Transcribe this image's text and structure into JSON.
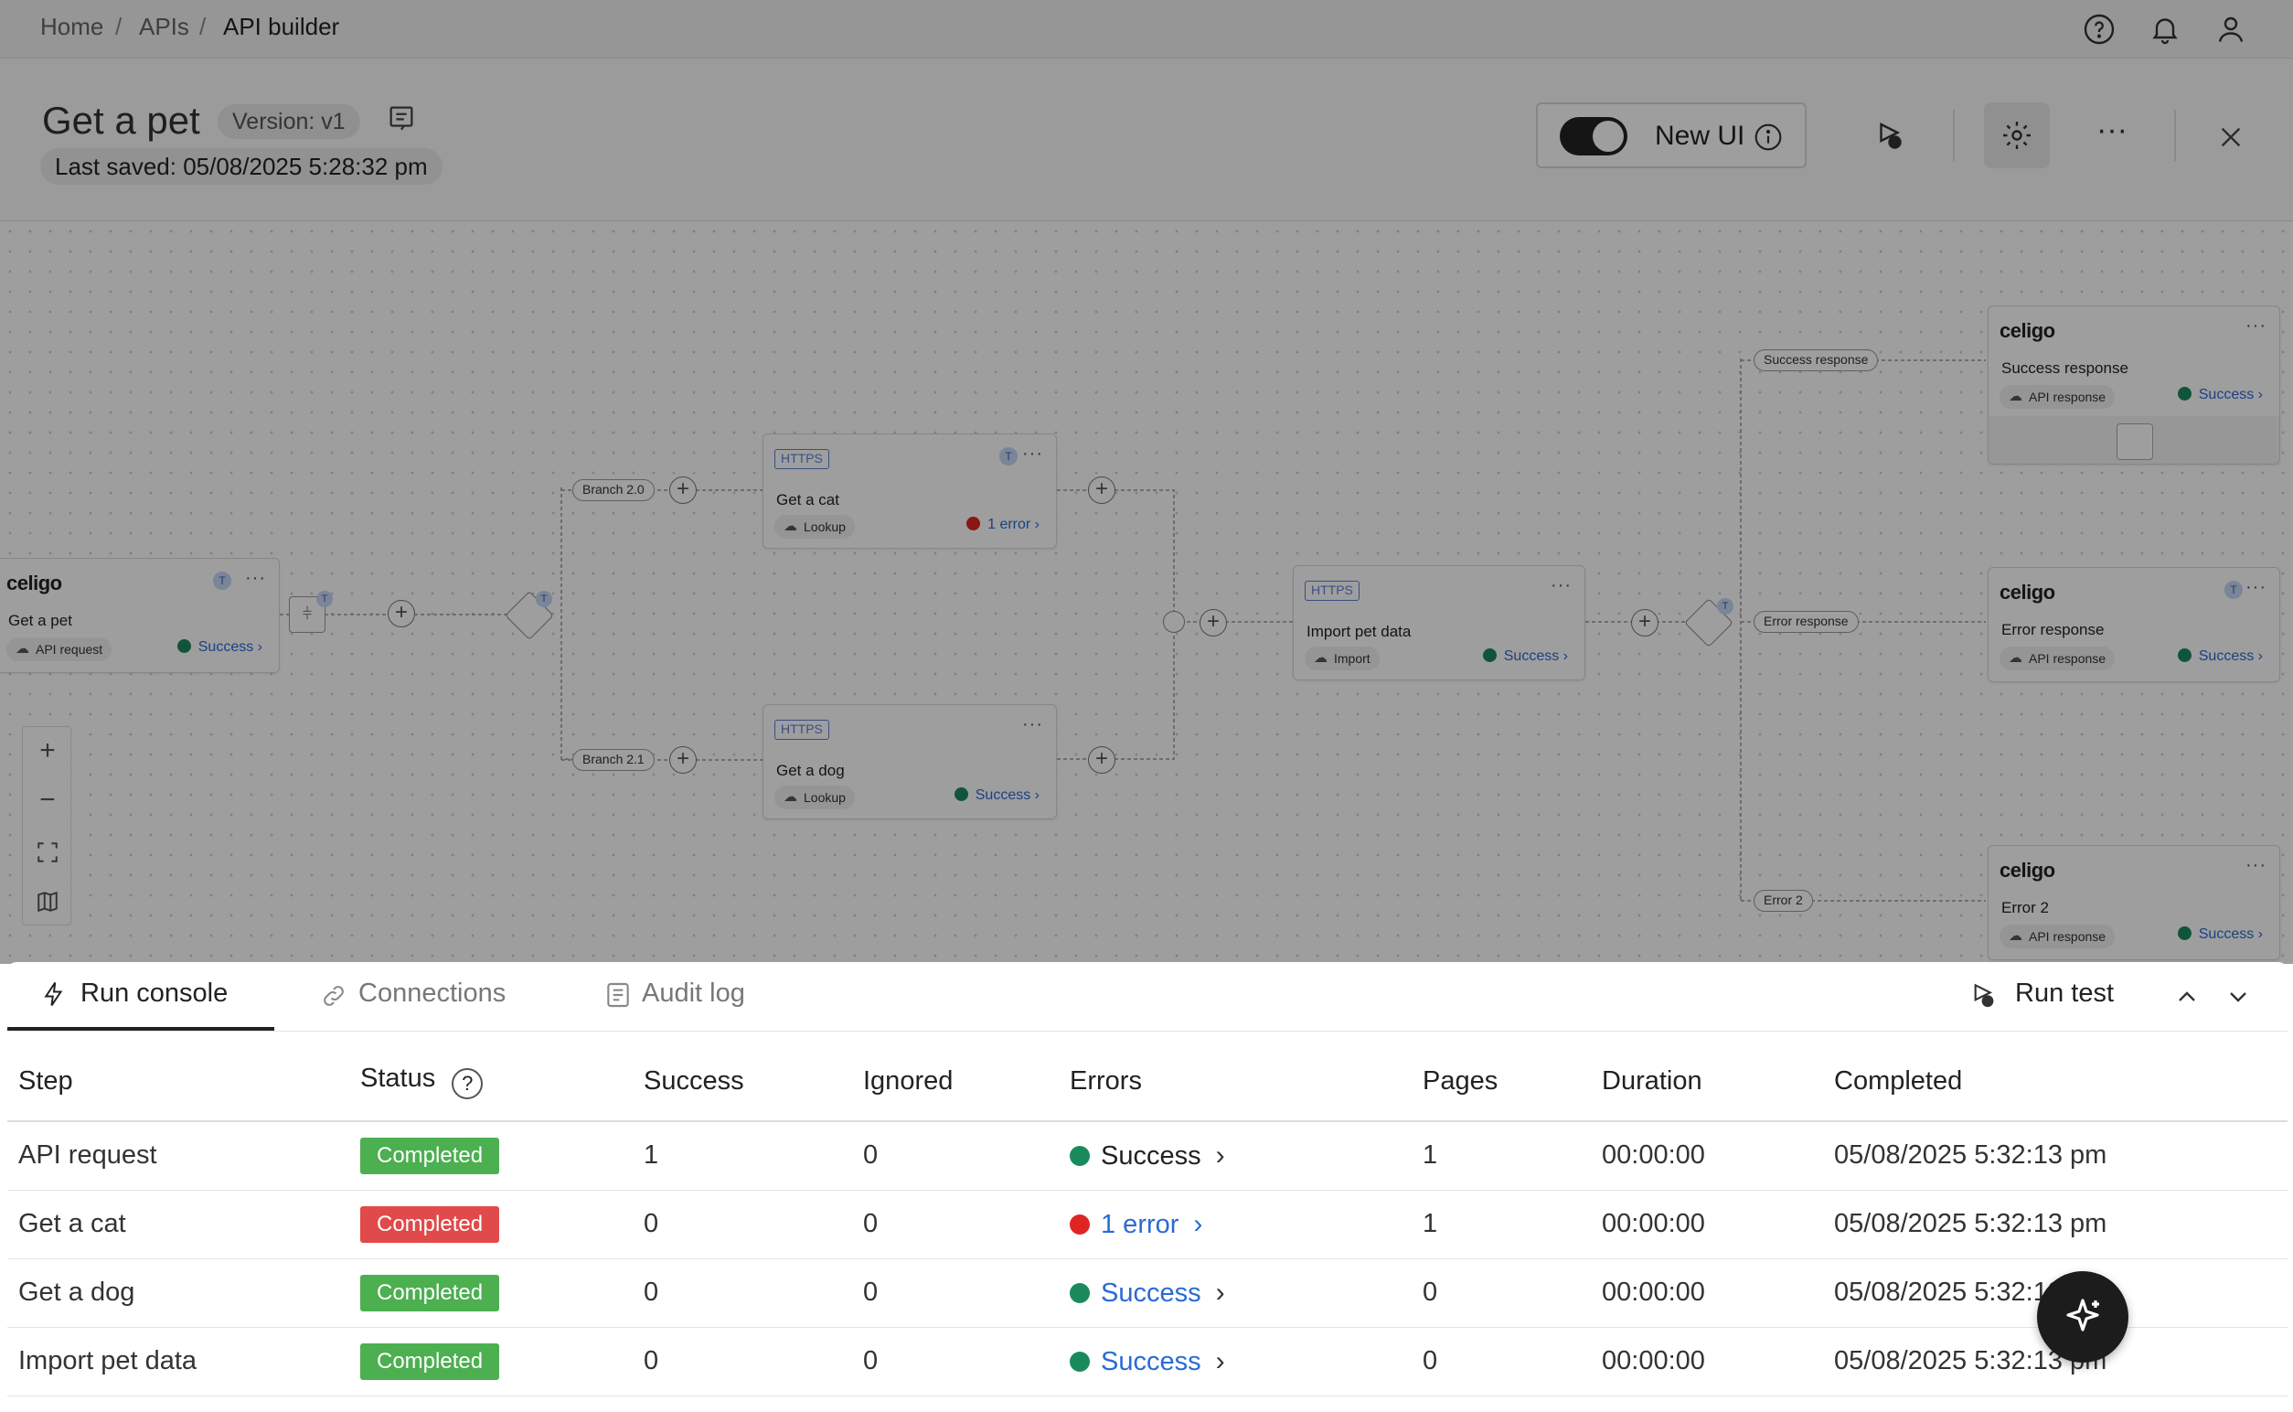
{
  "breadcrumb": {
    "home": "Home",
    "apis": "APIs",
    "current": "API builder",
    "sep": "/"
  },
  "header": {
    "title": "Get a pet",
    "version": "Version: v1",
    "last_saved": "Last saved: 05/08/2025 5:28:32 pm",
    "new_ui_label": "New UI",
    "new_ui_enabled": true,
    "more_label": "···"
  },
  "canvas": {
    "nodes": {
      "get_pet": {
        "brand": "celigo",
        "name": "Get a pet",
        "chip": "API request",
        "status": "Success",
        "badge": "T"
      },
      "get_cat": {
        "tag": "HTTPS",
        "name": "Get a cat",
        "chip": "Lookup",
        "status": "1 error",
        "badge": "T"
      },
      "get_dog": {
        "tag": "HTTPS",
        "name": "Get a dog",
        "chip": "Lookup",
        "status": "Success"
      },
      "import_pet": {
        "tag": "HTTPS",
        "name": "Import pet data",
        "chip": "Import",
        "status": "Success"
      },
      "success_resp": {
        "brand": "celigo",
        "name": "Success response",
        "chip": "API response",
        "status": "Success"
      },
      "error_resp": {
        "brand": "celigo",
        "name": "Error response",
        "chip": "API response",
        "status": "Success",
        "badge": "T"
      },
      "error2": {
        "brand": "celigo",
        "name": "Error 2",
        "chip": "API response",
        "status": "Success"
      }
    },
    "branch_labels": {
      "b20": "Branch 2.0",
      "b21": "Branch 2.1",
      "success": "Success response",
      "error": "Error response",
      "error2": "Error 2"
    },
    "more": "···"
  },
  "panel": {
    "tabs": [
      "Run console",
      "Connections",
      "Audit log"
    ],
    "run_test": "Run test",
    "columns": [
      "Step",
      "Status",
      "Success",
      "Ignored",
      "Errors",
      "Pages",
      "Duration",
      "Completed"
    ],
    "rows": [
      {
        "step": "API request",
        "status": "Completed",
        "success": "1",
        "ignored": "0",
        "errors": "Success",
        "pages": "1",
        "duration": "00:00:00",
        "completed": "05/08/2025 5:32:13 pm"
      },
      {
        "step": "Get a cat",
        "status": "Completed",
        "success": "0",
        "ignored": "0",
        "errors": "1 error",
        "pages": "1",
        "duration": "00:00:00",
        "completed": "05/08/2025 5:32:13 pm"
      },
      {
        "step": "Get a dog",
        "status": "Completed",
        "success": "0",
        "ignored": "0",
        "errors": "Success",
        "pages": "0",
        "duration": "00:00:00",
        "completed": "05/08/2025 5:32:13 pm"
      },
      {
        "step": "Import pet data",
        "status": "Completed",
        "success": "0",
        "ignored": "0",
        "errors": "Success",
        "pages": "0",
        "duration": "00:00:00",
        "completed": "05/08/2025 5:32:13 pm"
      }
    ]
  },
  "colors": {
    "success_dot": "#1a8a5c",
    "error_dot": "#e02424",
    "badge_ok": "#4caf50",
    "badge_err": "#e04a4a",
    "link": "#2a6ad6"
  },
  "icons": [
    "help-icon",
    "bell-icon",
    "user-icon",
    "notes-icon",
    "info-icon",
    "run-test-icon",
    "gear-icon",
    "more-icon",
    "close-icon",
    "run-console-icon",
    "link-icon",
    "audit-log-icon",
    "chevron-up-icon",
    "chevron-down-icon",
    "sparkle-icon",
    "zoom-in-icon",
    "zoom-out-icon",
    "fit-view-icon",
    "map-icon"
  ]
}
